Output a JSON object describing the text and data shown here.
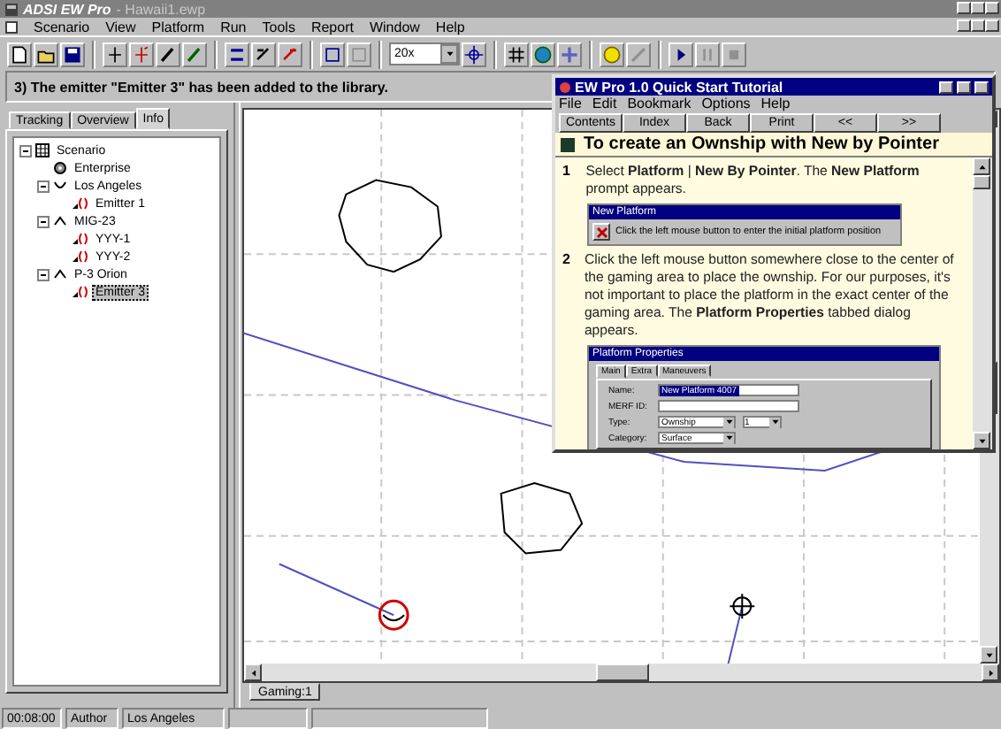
{
  "window": {
    "app_name": "ADSI EW Pro",
    "document": "- Hawaii1.ewp"
  },
  "menu": [
    "Scenario",
    "View",
    "Platform",
    "Run",
    "Tools",
    "Report",
    "Window",
    "Help"
  ],
  "toolbar": {
    "zoom": "20x"
  },
  "message": "3) The emitter \"Emitter 3\" has been added to the library.",
  "side_tabs": [
    {
      "label": "Tracking",
      "selected": false
    },
    {
      "label": "Overview",
      "selected": false
    },
    {
      "label": "Info",
      "selected": true
    }
  ],
  "tree": [
    {
      "label": "Scenario",
      "kind": "scenario",
      "expanded": true,
      "selected": false,
      "children": [
        {
          "label": "Enterprise",
          "kind": "ship",
          "selected": false
        },
        {
          "label": "Los Angeles",
          "kind": "sub",
          "expanded": true,
          "selected": false,
          "children": [
            {
              "label": "Emitter 1",
              "kind": "emitter",
              "selected": false
            }
          ]
        },
        {
          "label": "MIG-23",
          "kind": "air",
          "expanded": true,
          "selected": false,
          "children": [
            {
              "label": "YYY-1",
              "kind": "emitter",
              "selected": false
            },
            {
              "label": "YYY-2",
              "kind": "emitter",
              "selected": false
            }
          ]
        },
        {
          "label": "P-3 Orion",
          "kind": "air",
          "expanded": true,
          "selected": false,
          "children": [
            {
              "label": "Emitter 3",
              "kind": "emitter",
              "selected": true
            }
          ]
        }
      ]
    }
  ],
  "map_tabs": [
    {
      "label": "Gaming:1",
      "selected": true
    }
  ],
  "status_bar": [
    "00:08:00",
    "Author",
    "Los Angeles"
  ],
  "tutorial": {
    "title": "EW Pro 1.0 Quick Start Tutorial",
    "menu": [
      "File",
      "Edit",
      "Bookmark",
      "Options",
      "Help"
    ],
    "buttons": [
      "Contents",
      "Index",
      "Back",
      "Print",
      "<<",
      ">>"
    ],
    "heading": "To create an Ownship with New by Pointer",
    "steps": [
      {
        "number": "1",
        "text": "Select **Platform** | **New By Pointer**. The **New Platform** prompt appears."
      },
      {
        "number": "2",
        "text": "Click the left mouse button somewhere close to the center of the gaming area to place the ownship. For our purposes, it's not important to place the platform in the exact center of the gaming area. The **Platform Properties** tabbed dialog appears."
      }
    ],
    "prompt": {
      "title": "New Platform",
      "text": "Click the left mouse button to enter the initial platform position"
    },
    "properties": {
      "title": "Platform Properties",
      "tabs": [
        {
          "label": "Main",
          "selected": true
        },
        {
          "label": "Extra",
          "selected": false
        },
        {
          "label": "Maneuvers",
          "selected": false
        }
      ],
      "fields": [
        {
          "label": "Name:",
          "value": "New Platform 4007",
          "kind": "text",
          "highlighted": true
        },
        {
          "label": "MERF ID:",
          "kind": "text"
        },
        {
          "label": "Type:",
          "value": "Ownship",
          "extra": "1",
          "kind": "combo",
          "highlighted": false
        },
        {
          "label": "Category:",
          "value": "Surface",
          "kind": "combo",
          "highlighted": false
        }
      ]
    }
  }
}
